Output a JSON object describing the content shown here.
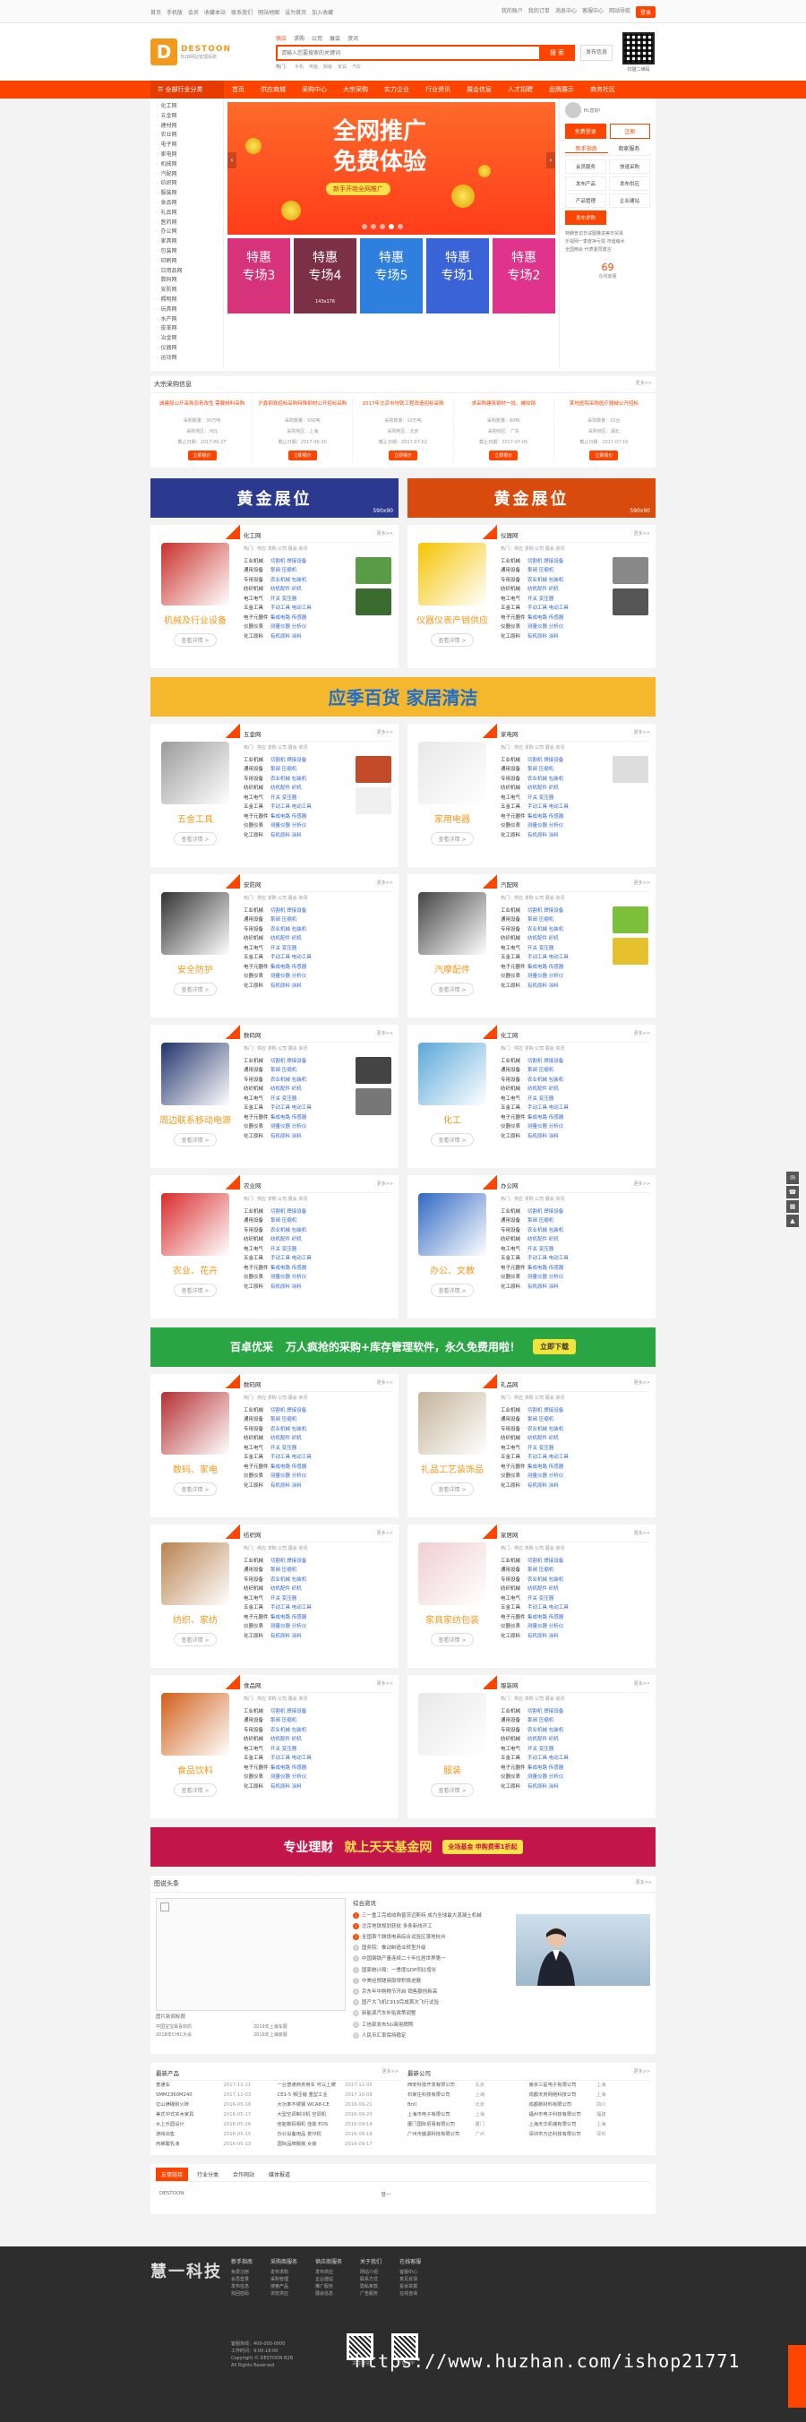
{
  "topbar": {
    "left": [
      "首页",
      "手机版",
      "会员",
      "收藏本站",
      "联系我们",
      "网站地图",
      "设为首页",
      "加入收藏"
    ],
    "right": [
      "我的账户",
      "我的订单",
      "消息中心",
      "客服中心",
      "网站导航"
    ],
    "login": "登录"
  },
  "header": {
    "logo_mark": "D",
    "logo_name": "DESTOON",
    "logo_slogan": "B2B网站管理系统",
    "search_tabs": [
      "供应",
      "求购",
      "公司",
      "展会",
      "资讯"
    ],
    "search_placeholder": "请输入您要搜索的关键词",
    "search_button": "搜 索",
    "post_button": "发布信息",
    "hot_label": "热门：",
    "hot_words": [
      "手机",
      "电脑",
      "服装",
      "家具",
      "汽车"
    ],
    "qr_label": "扫描二维码"
  },
  "nav": {
    "category_menu": "全部行业分类",
    "items": [
      "首页",
      "供应商城",
      "采购中心",
      "大宗采购",
      "实力企业",
      "行业资讯",
      "展会信息",
      "人才招聘",
      "品牌展示",
      "商务社区"
    ]
  },
  "side_categories": [
    "化工网",
    "五金网",
    "建材网",
    "农业网",
    "电子网",
    "家电网",
    "机械网",
    "汽配网",
    "纺织网",
    "服装网",
    "食品网",
    "礼品网",
    "医药网",
    "办公网",
    "家具网",
    "包装网",
    "印刷网",
    "日用品网",
    "数码网",
    "安防网",
    "照明网",
    "玩具网",
    "水产网",
    "皮革网",
    "冶金网",
    "仪器网",
    "运动网"
  ],
  "slider": {
    "title_line1": "全网推广",
    "title_line2": "免费体验",
    "subtitle": "新手开始全网推广",
    "dots": 5,
    "active_dot": 4
  },
  "specials": [
    {
      "label": "特惠\n专场3",
      "note": "",
      "color": "#d6337a"
    },
    {
      "label": "特惠\n专场4",
      "note": "143x176",
      "color": "#7c3048"
    },
    {
      "label": "特惠\n专场5",
      "note": "",
      "color": "#2f7fde"
    },
    {
      "label": "特惠\n专场1",
      "note": "",
      "color": "#3b63d8"
    },
    {
      "label": "特惠\n专场2",
      "note": "",
      "color": "#e0348c"
    }
  ],
  "user_panel": {
    "greeting": "Hi,您好!",
    "btn_login": "免费登录",
    "btn_register": "注册",
    "tabs": [
      "新手指南",
      "商家服务"
    ],
    "services": [
      "会员服务",
      "快速采购",
      "发布产品",
      "发布供应",
      "产品管理",
      "企业建站",
      "发布求购"
    ],
    "news": [
      "特朗普访日试图推进美日贸易",
      "乐视网一季度净亏损 市值缩水",
      "全国两会 代表委员建言"
    ],
    "stats": [
      {
        "value": "69",
        "label": "在线客服"
      }
    ]
  },
  "purchase": {
    "title": "大宗采购信息",
    "more": "更多>>",
    "items": [
      {
        "title": "城建局公开采购沥青改性 需要材料采购",
        "qty": "采购数量：30万吨",
        "area": "采购地区：河北",
        "date": "截止日期：2017-06-27",
        "btn": "立即报价"
      },
      {
        "title": "沪鑫钢铁招标采购特殊钢材公开招标采购",
        "qty": "采购数量：500吨",
        "area": "采购地区：上海",
        "date": "截止日期：2017-06-30",
        "btn": "立即报价"
      },
      {
        "title": "2017年北京市地铁工程改造招标采购",
        "qty": "采购数量：10万吨",
        "area": "采购地区：北京",
        "date": "截止日期：2017-07-02",
        "btn": "立即报价"
      },
      {
        "title": "求采购建筑钢材一批、螺纹钢",
        "qty": "采购数量：80吨",
        "area": "采购地区：广东",
        "date": "截止日期：2017-07-05",
        "btn": "立即报价"
      },
      {
        "title": "某地医院采购医疗器械公开招标",
        "qty": "采购数量：15台",
        "area": "采购地区：湖北",
        "date": "截止日期：2017-07-10",
        "btn": "立即报价"
      }
    ]
  },
  "gold_booths": [
    {
      "label": "黄金展位",
      "size": "590x90",
      "color": "#2b3a8f"
    },
    {
      "label": "黄金展位",
      "size": "590x90",
      "color": "#d84b0c"
    }
  ],
  "industries": [
    {
      "name": "机械及行业设备",
      "title": "化工网",
      "img": "#c9302c",
      "pics": [
        "#5a9b45",
        "#3c6b2f"
      ]
    },
    {
      "name": "仪器仪表产销供应",
      "title": "仪器网",
      "img": "#f5c400",
      "pics": [
        "#888",
        "#555"
      ]
    },
    {
      "name": "五金工具",
      "title": "五金网",
      "img": "#9b9b9b",
      "pics": [
        "#c44b2a",
        "#f0f0f0"
      ]
    },
    {
      "name": "家用电器",
      "title": "家电网",
      "img": "#e8e8e8",
      "pics": [
        "#ddd"
      ]
    },
    {
      "name": "安全防护",
      "title": "安防网",
      "img": "#333",
      "pics": []
    },
    {
      "name": "汽摩配件",
      "title": "汽配网",
      "img": "#444",
      "pics": [
        "#7cbf3a",
        "#e6c02d"
      ]
    },
    {
      "name": "周边联系移动电源",
      "title": "数码网",
      "img": "#21336b",
      "pics": [
        "#444",
        "#777"
      ]
    },
    {
      "name": "化工",
      "title": "化工网",
      "img": "#59a7d9",
      "pics": []
    },
    {
      "name": "农业、花卉",
      "title": "农业网",
      "img": "#d82c2c",
      "pics": []
    },
    {
      "name": "办公、文教",
      "title": "办公网",
      "img": "#3169c4",
      "pics": []
    },
    {
      "name": "数码、家电",
      "title": "数码网",
      "img": "#b52f32",
      "pics": []
    },
    {
      "name": "礼品工艺装饰品",
      "title": "礼品网",
      "img": "#c4b49a",
      "pics": []
    },
    {
      "name": "纺织、家纺",
      "title": "纺织网",
      "img": "#b88350",
      "pics": []
    },
    {
      "name": "家具家纺包装",
      "title": "家居网",
      "img": "#f0cfd2",
      "pics": []
    },
    {
      "name": "食品饮料",
      "title": "食品网",
      "img": "#d1601b",
      "pics": []
    },
    {
      "name": "服装",
      "title": "服装网",
      "img": "#e9e9e9",
      "pics": []
    }
  ],
  "ind_common": {
    "more": "更多>>",
    "hot": "热门：供应 求购 公司 展会 资讯",
    "detail": "查看详情 >",
    "keys": [
      "工业机械",
      "通用设备",
      "专用设备",
      "纺织机械",
      "电工电气",
      "五金工具",
      "电子元器件",
      "仪器仪表",
      "化工原料"
    ],
    "vals": [
      "切割机 焊接设备",
      "泵阀 压缩机",
      "农业机械 包装机",
      "纺机配件 织机",
      "开关 变压器",
      "手动工具 电动工具",
      "集成电路 传感器",
      "测量仪器 分析仪",
      "有机原料 涂料"
    ]
  },
  "ad_season": {
    "text": "应季百货  家居清洁",
    "bg": "#f5b72b",
    "color": "#1d6fd0"
  },
  "ad_app": {
    "logo": "百卓优采",
    "text": "万人疯抢的采购+库存管理软件，永久免费用啦！",
    "btn": "立即下载",
    "bg": "#2aa544"
  },
  "ad_fund": {
    "left": "专业理财",
    "mid": "就上天天基金网",
    "right": "全场基金 申购费率1折起",
    "bg": "#c2154a"
  },
  "news": {
    "title": "图说头条",
    "more": "更多>>",
    "photo_caption": "图片新闻标题",
    "links": [
      "中国宝宝最喜欢的",
      "2019年上海车展",
      "2018年CHIC大会",
      "2019年上海房展"
    ],
    "list_title": "综合资讯",
    "items": [
      "三一重工完成收购普茨迈斯特 成为全球最大混凝土机械",
      "北京地铁规划获批 多条新线开工",
      "全国首个跨境电商综合试验区落地杭州",
      "国务院：推动制造业转型升级",
      "中国钢铁产量连续二十年位居世界第一",
      "国家统计局：一季度GDP同比增长",
      "中美经贸磋商取得积极进展",
      "京东年中购物节开启 销售额创新高",
      "国产大飞机C919完成首次飞行试验",
      "新能源汽车补贴政策调整",
      "工信部发布5G商用牌照",
      "人民币汇率保持稳定"
    ]
  },
  "products": {
    "title": "最新产品",
    "more": "更多>>",
    "items": [
      {
        "a": "普通车",
        "b": "2017-12-21",
        "c": "一台普通商务用车 可以上牌",
        "d": "2017-11-05"
      },
      {
        "a": "SMM2360M240",
        "b": "2017-11-03",
        "c": "CE1-5 频压缩 重型工业",
        "d": "2017-10-08"
      },
      {
        "a": "亿山镁碳耐火砖",
        "b": "2016-05-18",
        "c": "大功率不锈钢 WCA8-CE",
        "d": "2016-09-21"
      },
      {
        "a": "美式中式实木家具",
        "b": "2016-05-17",
        "c": "大型空调制冷机 空调机",
        "d": "2016-09-20"
      },
      {
        "a": "水上乐园设计",
        "b": "2016-05-16",
        "c": "佳能数码相机 佳能 EOS",
        "d": "2016-09-19"
      },
      {
        "a": "游戏出售",
        "b": "2016-05-15",
        "c": "办公设备用品 复印机",
        "d": "2016-09-18"
      },
      {
        "a": "丙烯酸乳液",
        "b": "2016-05-13",
        "c": "国际品牌服装 女装",
        "d": "2016-09-17"
      }
    ]
  },
  "companies": {
    "title": "最新公司",
    "more": "更多>>",
    "items": [
      {
        "a": "西安科技开发有限公司",
        "b": "北京",
        "c": "南京三星电子有限公司",
        "d": "上海"
      },
      {
        "a": "石家庄科技有限公司",
        "b": "上海",
        "c": "成都天府网络科技公司",
        "d": "上海"
      },
      {
        "a": "Bnll",
        "b": "北京",
        "c": "成都新材料有限公司",
        "d": "四川"
      },
      {
        "a": "上海市电子有限公司",
        "b": "上海",
        "c": "福州市电子科技有限公司",
        "d": "福建"
      },
      {
        "a": "厦门国际贸易有限公司",
        "b": "厦门",
        "c": "上海天华机械有限公司",
        "d": "上海"
      },
      {
        "a": "广州市盛源科技有限公司",
        "b": "广州",
        "c": "深圳市万达科技有限公司",
        "d": "深圳"
      }
    ]
  },
  "friend_links": {
    "tabs": [
      "友情链接",
      "行业分类",
      "合作网站",
      "媒体报道"
    ],
    "items": [
      "DESTOON",
      "慧一"
    ]
  },
  "footer": {
    "brand": "慧一科技",
    "cols": [
      {
        "title": "新手指南",
        "items": [
          "免费注册",
          "会员登录",
          "发布信息",
          "找回密码"
        ]
      },
      {
        "title": "采购商服务",
        "items": [
          "发布求购",
          "采购管理",
          "搜索产品",
          "浏览供应"
        ]
      },
      {
        "title": "供应商服务",
        "items": [
          "发布供应",
          "企业建站",
          "推广服务",
          "展会信息"
        ]
      },
      {
        "title": "关于我们",
        "items": [
          "网站介绍",
          "联系方式",
          "隐私条款",
          "广告服务"
        ]
      },
      {
        "title": "在线客服",
        "items": [
          "客服中心",
          "意见反馈",
          "投诉举报",
          "在线咨询"
        ]
      }
    ],
    "info": [
      "客服热线：400-000-0000",
      "工作时间：9:00-18:00",
      "Copyright © DESTOON B2B",
      "All Rights Reserved"
    ],
    "qrs": [
      "关注微信",
      "下载APP"
    ],
    "watermark": "https://www.huzhan.com/ishop21771"
  }
}
